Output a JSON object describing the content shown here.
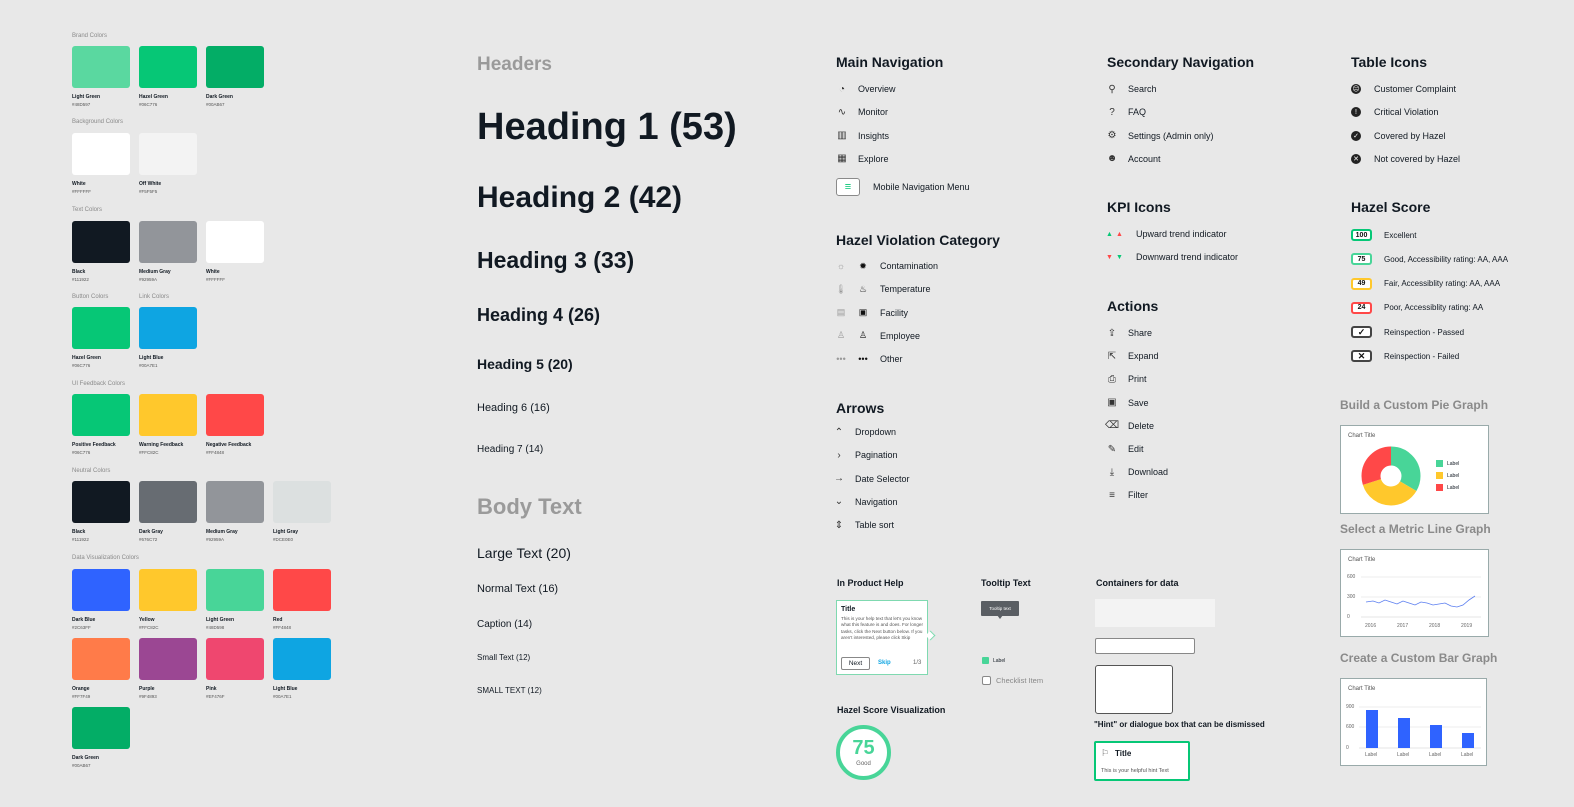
{
  "colors": {
    "brand": {
      "title": "Brand Colors",
      "items": [
        {
          "name": "Light Green",
          "hex": "#48D597",
          "color": "#5ad8a0"
        },
        {
          "name": "Hazel Green",
          "hex": "#06C776",
          "color": "#06c776"
        },
        {
          "name": "Dark Green",
          "hex": "#00AB67",
          "color": "#03ad66"
        }
      ]
    },
    "background": {
      "title": "Background Colors",
      "items": [
        {
          "name": "White",
          "hex": "#FFFFFF",
          "color": "#ffffff"
        },
        {
          "name": "Off White",
          "hex": "#F5F5F5",
          "color": "#f3f3f3"
        }
      ]
    },
    "text": {
      "title": "Text Colors",
      "items": [
        {
          "name": "Black",
          "hex": "#111922",
          "color": "#111922"
        },
        {
          "name": "Medium Gray",
          "hex": "#92959A",
          "color": "#92959a"
        },
        {
          "name": "White",
          "hex": "#FFFFFF",
          "color": "#ffffff"
        }
      ]
    },
    "button": {
      "title": "Button Colors",
      "items": [
        {
          "name": "Hazel Green",
          "hex": "#06C776",
          "color": "#06c776"
        }
      ]
    },
    "link": {
      "title": "Link Colors",
      "items": [
        {
          "name": "Light Blue",
          "hex": "#00A7E1",
          "color": "#0ea5e2"
        }
      ]
    },
    "feedback": {
      "title": "UI Feedback Colors",
      "items": [
        {
          "name": "Positive Feedback",
          "hex": "#06C776",
          "color": "#06c776"
        },
        {
          "name": "Warning Feedback",
          "hex": "#FFC82C",
          "color": "#ffc82c"
        },
        {
          "name": "Negative Feedback",
          "hex": "#FF4848",
          "color": "#ff4848"
        }
      ]
    },
    "neutral": {
      "title": "Neutral Colors",
      "items": [
        {
          "name": "Black",
          "hex": "#111922",
          "color": "#111922"
        },
        {
          "name": "Dark Gray",
          "hex": "#676C72",
          "color": "#676c72"
        },
        {
          "name": "Medium Gray",
          "hex": "#92959A",
          "color": "#92959a"
        },
        {
          "name": "Light Gray",
          "hex": "#DCE0E0",
          "color": "#dce0e0"
        }
      ]
    },
    "dataviz": {
      "title": "Data Visualization Colors",
      "items": [
        {
          "name": "Dark Blue",
          "hex": "#2C63FF",
          "color": "#2f63ff"
        },
        {
          "name": "Yellow",
          "hex": "#FFC82C",
          "color": "#ffc82c"
        },
        {
          "name": "Light Green",
          "hex": "#48D598",
          "color": "#48d598"
        },
        {
          "name": "Red",
          "hex": "#FF4848",
          "color": "#ff4848"
        },
        {
          "name": "Orange",
          "hex": "#FF7F49",
          "color": "#ff7b49"
        },
        {
          "name": "Purple",
          "hex": "#9F4893",
          "color": "#9b4793"
        },
        {
          "name": "Pink",
          "hex": "#EF476F",
          "color": "#ef476f"
        },
        {
          "name": "Light Blue",
          "hex": "#00A7E1",
          "color": "#0ea5e2"
        },
        {
          "name": "Dark Green",
          "hex": "#00AB67",
          "color": "#03ad66"
        }
      ]
    }
  },
  "headers": {
    "section_title": "Headers",
    "h1": "Heading 1 (53)",
    "h2": "Heading 2 (42)",
    "h3": "Heading 3 (33)",
    "h4": "Heading 4 (26)",
    "h5": "Heading 5 (20)",
    "h6": "Heading 6 (16)",
    "h7": "Heading 7 (14)"
  },
  "body_text": {
    "section_title": "Body Text",
    "large": "Large Text (20)",
    "normal": "Normal Text (16)",
    "caption": "Caption (14)",
    "small": "Small Text (12)",
    "small_caps": "SMALL TEXT (12)"
  },
  "main_nav": {
    "title": "Main Navigation",
    "items": [
      {
        "label": "Overview",
        "icon": "gauge-icon",
        "glyph": "◔"
      },
      {
        "label": "Monitor",
        "icon": "pulse-icon",
        "glyph": "∿"
      },
      {
        "label": "Insights",
        "icon": "bar-chart-icon",
        "glyph": "▥"
      },
      {
        "label": "Explore",
        "icon": "grid-icon",
        "glyph": "▦"
      }
    ],
    "mobile_menu": "Mobile Navigation Menu"
  },
  "violation": {
    "title": "Hazel Violation Category",
    "items": [
      {
        "label": "Contamination",
        "icon": "bug-icon",
        "g1": "☼",
        "g2": "✹"
      },
      {
        "label": "Temperature",
        "icon": "thermometer-icon",
        "g1": "🌡",
        "g2": "♨"
      },
      {
        "label": "Facility",
        "icon": "facility-icon",
        "g1": "▤",
        "g2": "▣"
      },
      {
        "label": "Employee",
        "icon": "person-icon",
        "g1": "♙",
        "g2": "♙"
      },
      {
        "label": "Other",
        "icon": "ellipsis-icon",
        "g1": "•••",
        "g2": "•••"
      }
    ]
  },
  "arrows": {
    "title": "Arrows",
    "items": [
      {
        "label": "Dropdown",
        "icon": "updown-icon",
        "glyph": "⌃"
      },
      {
        "label": "Pagination",
        "icon": "chevron-right-icon",
        "glyph": "›"
      },
      {
        "label": "Date Selector",
        "icon": "arrow-right-icon",
        "glyph": "→"
      },
      {
        "label": "Navigation",
        "icon": "chevron-down-icon",
        "glyph": "⌄"
      },
      {
        "label": "Table sort",
        "icon": "sort-icon",
        "glyph": "⇕"
      }
    ]
  },
  "secondary_nav": {
    "title": "Secondary Navigation",
    "items": [
      {
        "label": "Search",
        "icon": "search-icon",
        "glyph": "⚲"
      },
      {
        "label": "FAQ",
        "icon": "question-icon",
        "glyph": "?"
      },
      {
        "label": "Settings (Admin only)",
        "icon": "gear-icon",
        "glyph": "⚙"
      },
      {
        "label": "Account",
        "icon": "account-icon",
        "glyph": "☻"
      }
    ]
  },
  "kpi": {
    "title": "KPI Icons",
    "items": [
      {
        "label": "Upward trend indicator",
        "icon": "trend-up-icon",
        "g1": "▲",
        "g2": "▲",
        "c1": "#06c776",
        "c2": "#ff4848"
      },
      {
        "label": "Downward trend indicator",
        "icon": "trend-down-icon",
        "g1": "▼",
        "g2": "▼",
        "c1": "#ff4848",
        "c2": "#06c776"
      }
    ]
  },
  "actions": {
    "title": "Actions",
    "items": [
      {
        "label": "Share",
        "icon": "share-icon",
        "glyph": "⇪"
      },
      {
        "label": "Expand",
        "icon": "expand-icon",
        "glyph": "⇱"
      },
      {
        "label": "Print",
        "icon": "print-icon",
        "glyph": "⎙"
      },
      {
        "label": "Save",
        "icon": "save-icon",
        "glyph": "▣"
      },
      {
        "label": "Delete",
        "icon": "trash-icon",
        "glyph": "⌫"
      },
      {
        "label": "Edit",
        "icon": "pencil-icon",
        "glyph": "✎"
      },
      {
        "label": "Download",
        "icon": "download-icon",
        "glyph": "⤓"
      },
      {
        "label": "Filter",
        "icon": "filter-icon",
        "glyph": "≡"
      }
    ]
  },
  "table_icons": {
    "title": "Table Icons",
    "items": [
      {
        "label": "Customer Complaint",
        "icon": "frown-icon",
        "glyph": "☹"
      },
      {
        "label": "Critical Violation",
        "icon": "alert-icon",
        "glyph": "!"
      },
      {
        "label": "Covered by Hazel",
        "icon": "check-circle-icon",
        "glyph": "✓"
      },
      {
        "label": "Not covered by Hazel",
        "icon": "x-circle-icon",
        "glyph": "✕"
      }
    ]
  },
  "hazel_score": {
    "title": "Hazel Score",
    "items": [
      {
        "value": "100",
        "label": "Excellent",
        "color": "#06c776"
      },
      {
        "value": "75",
        "label": "Good, Accessibility rating: AA, AAA",
        "color": "#48d598"
      },
      {
        "value": "49",
        "label": "Fair, Accessiblity rating: AA, AAA",
        "color": "#ffc82c"
      },
      {
        "value": "24",
        "label": "Poor, Accessiblity rating: AA",
        "color": "#ff4848"
      }
    ],
    "reinspection": [
      {
        "label": "Reinspection - Passed",
        "glyph": "✓",
        "icon": "check-box-icon"
      },
      {
        "label": "Reinspection - Failed",
        "glyph": "✕",
        "icon": "x-box-icon"
      }
    ]
  },
  "pie": {
    "section_title": "Build a Custom Pie Graph",
    "chart_title": "Chart Title",
    "legend": [
      "Label",
      "Label",
      "Label"
    ]
  },
  "line": {
    "section_title": "Select a Metric Line Graph",
    "chart_title": "Chart Title",
    "yticks": [
      "600",
      "300",
      "0"
    ],
    "xticks": [
      "2016",
      "2017",
      "2018",
      "2019"
    ]
  },
  "bar": {
    "section_title": "Create a Custom Bar Graph",
    "chart_title": "Chart Title",
    "yticks": [
      "900",
      "600",
      "0"
    ],
    "xticks": [
      "Label",
      "Label",
      "Label",
      "Label"
    ]
  },
  "in_product_help": {
    "title": "In Product Help",
    "card_title": "Title",
    "card_body": "This is your help text that let's you know what this feature is and does. For longer tasks, click the Next button below. If you aren't interested, please click Skip",
    "next": "Next",
    "skip": "Skip",
    "pager": "1/3"
  },
  "tooltip": {
    "title": "Tooltip Text",
    "text": "Tooltip text",
    "legend_label": "Label",
    "checklist": "Checklist Item"
  },
  "containers": {
    "title": "Containers for data",
    "hint_caption": "\"Hint\" or dialogue box that can be dismissed",
    "hint_title": "Title",
    "hint_body": "This is your helpful hint Text"
  },
  "score_viz": {
    "title": "Hazel Score Visualization",
    "value": "75",
    "label": "Good"
  }
}
